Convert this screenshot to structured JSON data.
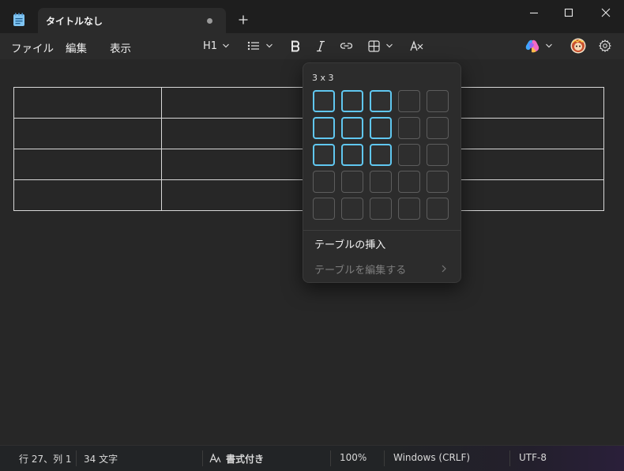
{
  "window": {
    "tab_title": "タイトルなし",
    "new_tab_icon": "plus-icon",
    "controls": [
      "minimize-icon",
      "maximize-icon",
      "close-icon"
    ]
  },
  "menu": {
    "items": [
      {
        "label": "ファイル"
      },
      {
        "label": "編集"
      },
      {
        "label": "表示"
      }
    ]
  },
  "toolbar": {
    "heading_label": "H1",
    "icons": [
      "list-icon",
      "bold-icon",
      "italic-icon",
      "link-icon",
      "table-icon",
      "clear-formatting-icon",
      "copilot-icon",
      "avatar",
      "gear-icon"
    ]
  },
  "document": {
    "table": {
      "rows": [
        [
          "",
          "",
          ""
        ],
        [
          "",
          "",
          ""
        ],
        [
          "",
          "",
          ""
        ],
        [
          "",
          "",
          ""
        ]
      ]
    }
  },
  "table_picker": {
    "size_label": "3 x 3",
    "selected_rows": 3,
    "selected_cols": 3,
    "grid_rows": 5,
    "grid_cols": 5,
    "insert_label": "テーブルの挿入",
    "edit_label": "テーブルを編集する"
  },
  "status": {
    "position": "行 27、列 1",
    "char_count": "34 文字",
    "format_mode": "書式付き",
    "zoom": "100%",
    "line_ending": "Windows (CRLF)",
    "encoding": "UTF-8"
  },
  "colors": {
    "accent": "#60c7f0",
    "background": "#272727",
    "titlebar": "#1e1e1e"
  }
}
